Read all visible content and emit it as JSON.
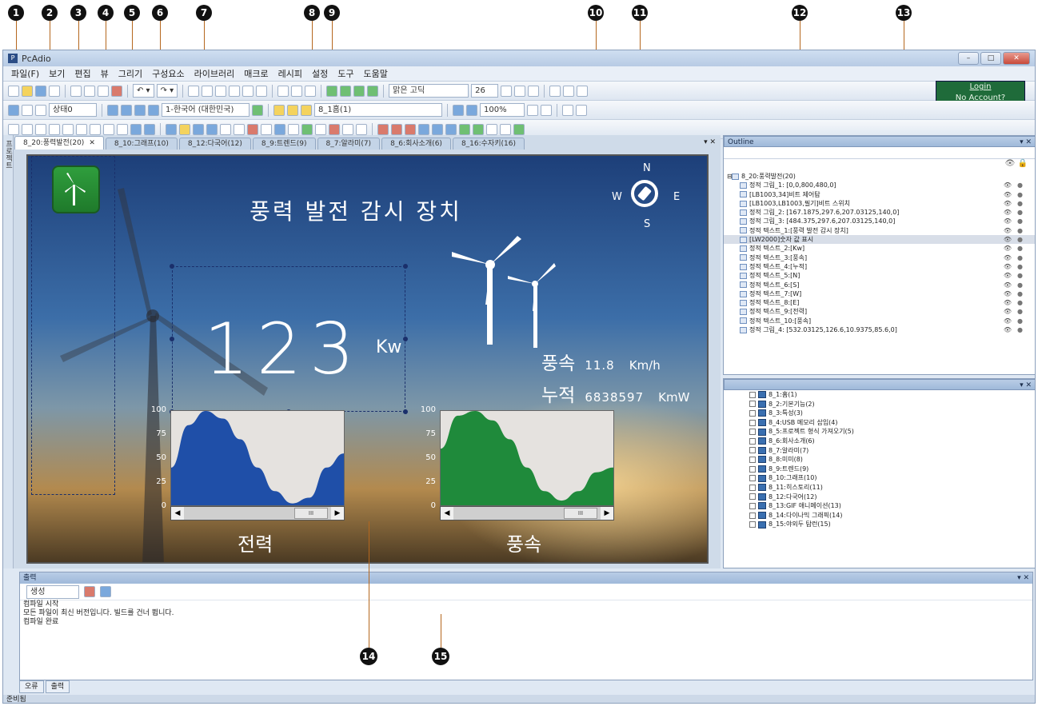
{
  "callouts": [
    "1",
    "2",
    "3",
    "4",
    "5",
    "6",
    "7",
    "8",
    "9",
    "10",
    "11",
    "12",
    "13",
    "14",
    "15"
  ],
  "window": {
    "title": "PcAdio"
  },
  "menu": [
    "파일(F)",
    "보기",
    "편집",
    "뷰",
    "그리기",
    "구성요소",
    "라이브러리",
    "매크로",
    "레시피",
    "설정",
    "도구",
    "도움말"
  ],
  "toolbar": {
    "state_label": "상태0",
    "language": "1-한국어 (대한민국)",
    "screen_select": "8_1홈(1)",
    "zoom": "100%",
    "font_name": "맑은 고딕",
    "font_size": "26",
    "login": "Login",
    "no_account": "No Account?"
  },
  "tabs": [
    {
      "label": "8_20:풍력발전(20)",
      "active": true
    },
    {
      "label": "8_10:그래프(10)",
      "active": false
    },
    {
      "label": "8_12:다국어(12)",
      "active": false
    },
    {
      "label": "8_9:트렌드(9)",
      "active": false
    },
    {
      "label": "8_7:알라미(7)",
      "active": false
    },
    {
      "label": "8_6:회사소개(6)",
      "active": false
    },
    {
      "label": "8_16:수자키(16)",
      "active": false
    }
  ],
  "side_strip": "프로젝트",
  "screen": {
    "heading": "풍력 발전 감시 장치",
    "compass": {
      "n": "N",
      "s": "S",
      "w": "W",
      "e": "E"
    },
    "power_value": "123",
    "power_unit": "Kw",
    "wind_label": "풍속",
    "wind_value": "11.8",
    "wind_unit": "Km/h",
    "total_label": "누적",
    "total_value": "6838597",
    "total_unit": "KmW",
    "chart_power_caption": "전력",
    "chart_wind_caption": "풍속",
    "scroll_thumb": "III"
  },
  "chart_data": [
    {
      "type": "area",
      "title": "전력",
      "ylim": [
        0,
        100
      ],
      "y_ticks": [
        "100",
        "75",
        "50",
        "25",
        "0"
      ],
      "values": [
        40,
        85,
        100,
        92,
        70,
        40,
        15,
        2,
        8,
        40,
        55
      ],
      "color": "#1f4fa8"
    },
    {
      "type": "area",
      "title": "풍속",
      "ylim": [
        0,
        100
      ],
      "y_ticks": [
        "100",
        "75",
        "50",
        "25",
        "0"
      ],
      "values": [
        60,
        95,
        100,
        90,
        70,
        40,
        15,
        5,
        15,
        35,
        40
      ],
      "color": "#1f8a3b"
    }
  ],
  "outline": {
    "title": "Outline",
    "root": "8_20:풍력발전(20)",
    "items": [
      "정적 그림_1: [0,0,800,480,0]",
      "[LB1003,34]비트 제어탐",
      "[LB1003,LB1003,필기]비트 스위치",
      "정적 그림_2: [167.1875,297.6,207.03125,140,0]",
      "정적 그림_3: [484.375,297.6,207.03125,140,0]",
      "정적 텍스트_1:[풍력 발전 감시 장치]",
      "[LW2000]숫자 값 표시",
      "정적 텍스트_2:[Kw]",
      "정적 텍스트_3:[풍속]",
      "정적 텍스트_4:[누적]",
      "정적 텍스트_5:[N]",
      "정적 텍스트_6:[S]",
      "정적 텍스트_7:[W]",
      "정적 텍스트_8:[E]",
      "정적 텍스트_9:[전력]",
      "정적 텍스트_10:[풍속]",
      "정적 그림_4: [532.03125,126.6,10.9375,85.6,0]"
    ],
    "selected_index": 6
  },
  "project": {
    "title": "",
    "items": [
      "8_1:홈(1)",
      "8_2:기본기능(2)",
      "8_3:특성(3)",
      "8_4:USB 메모리 삽입(4)",
      "8_5:프로젝트 형식 가져오기(5)",
      "8_6:회사소개(6)",
      "8_7:알라미(7)",
      "8_8:미미(8)",
      "8_9:트렌드(9)",
      "8_10:그래프(10)",
      "8_11:히스토리(11)",
      "8_12:다국어(12)",
      "8_13:GIF 애니메이션(13)",
      "8_14:다이나믹 그래픽(14)",
      "8_15:야외두 탐런(15)"
    ]
  },
  "output": {
    "title": "출력",
    "filter": "생성",
    "lines": [
      "컴파일 시작",
      "모든 파일이 최신 버전입니다. 빌드를 건너 뜁니다.",
      "컴파일 완료"
    ]
  },
  "bottom_tabs": [
    "오류",
    "출력"
  ],
  "status": "준비됨",
  "colors": {
    "accent": "#1f6b3a",
    "power_fill": "#1f4fa8",
    "wind_fill": "#1f8a3b",
    "callout_line": "#b5671e"
  }
}
